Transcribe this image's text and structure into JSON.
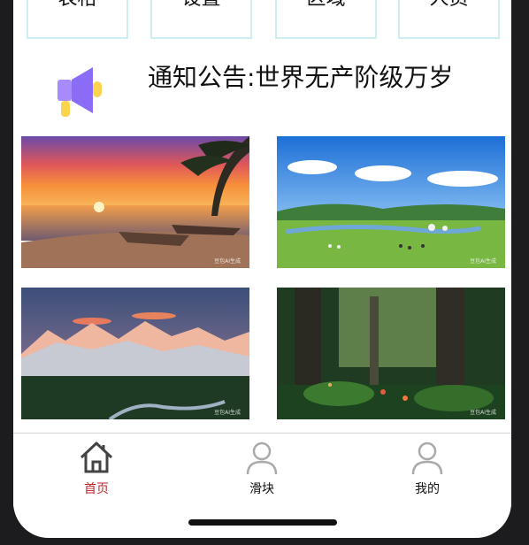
{
  "top_menu": {
    "items": [
      {
        "label": "表格"
      },
      {
        "label": "设置"
      },
      {
        "label": "区域"
      },
      {
        "label": "人员"
      }
    ]
  },
  "notice": {
    "icon": "megaphone-icon",
    "text": "通知公告:世界无产阶级万岁"
  },
  "gallery": {
    "images": [
      {
        "name": "beach-sunset-image",
        "watermark": "豆包AI生成"
      },
      {
        "name": "grassland-image",
        "watermark": "豆包AI生成"
      },
      {
        "name": "mountain-image",
        "watermark": "豆包AI生成"
      },
      {
        "name": "forest-image",
        "watermark": "豆包AI生成"
      }
    ]
  },
  "tabbar": {
    "active_color": "#c0262c",
    "items": [
      {
        "label": "首页",
        "icon": "home-icon",
        "active": true
      },
      {
        "label": "滑块",
        "icon": "user-icon",
        "active": false
      },
      {
        "label": "我的",
        "icon": "user-icon",
        "active": false
      }
    ]
  }
}
